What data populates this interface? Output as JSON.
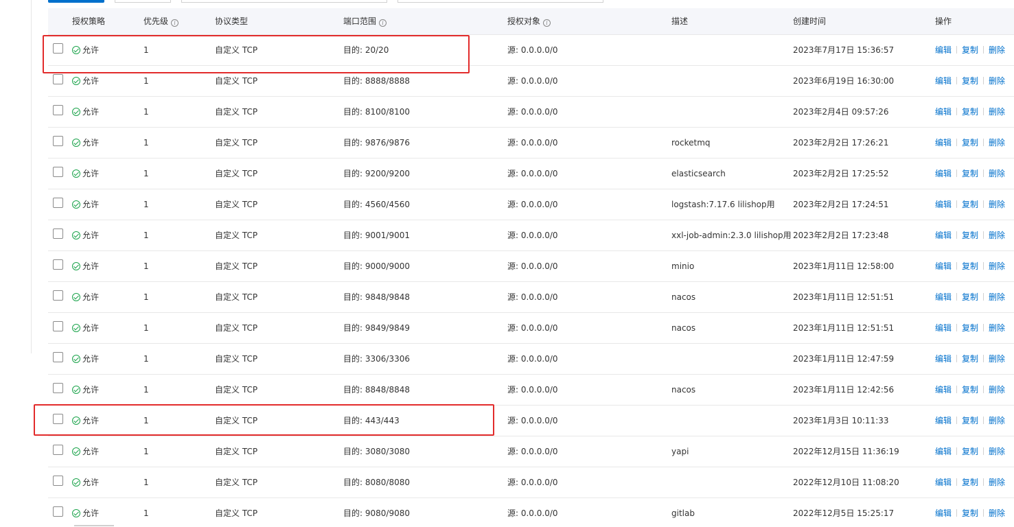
{
  "header": {
    "policy": "授权策略",
    "priority": "优先级",
    "protocol": "协议类型",
    "port_range": "端口范围",
    "auth_object": "授权对象",
    "description": "描述",
    "created_time": "创建时间",
    "actions": "操作"
  },
  "header_info_glyph": "i",
  "action_labels": {
    "edit": "编辑",
    "copy": "复制",
    "delete": "删除"
  },
  "rules": [
    {
      "policy": "允许",
      "priority": "1",
      "protocol": "自定义 TCP",
      "port": "目的: 20/20",
      "source": "源: 0.0.0.0/0",
      "description": "",
      "created": "2023年7月17日 15:36:57"
    },
    {
      "policy": "允许",
      "priority": "1",
      "protocol": "自定义 TCP",
      "port": "目的: 8888/8888",
      "source": "源: 0.0.0.0/0",
      "description": "",
      "created": "2023年6月19日 16:30:00"
    },
    {
      "policy": "允许",
      "priority": "1",
      "protocol": "自定义 TCP",
      "port": "目的: 8100/8100",
      "source": "源: 0.0.0.0/0",
      "description": "",
      "created": "2023年2月4日 09:57:26"
    },
    {
      "policy": "允许",
      "priority": "1",
      "protocol": "自定义 TCP",
      "port": "目的: 9876/9876",
      "source": "源: 0.0.0.0/0",
      "description": "rocketmq",
      "created": "2023年2月2日 17:26:21"
    },
    {
      "policy": "允许",
      "priority": "1",
      "protocol": "自定义 TCP",
      "port": "目的: 9200/9200",
      "source": "源: 0.0.0.0/0",
      "description": "elasticsearch",
      "created": "2023年2月2日 17:25:52"
    },
    {
      "policy": "允许",
      "priority": "1",
      "protocol": "自定义 TCP",
      "port": "目的: 4560/4560",
      "source": "源: 0.0.0.0/0",
      "description": "logstash:7.17.6 lilishop用",
      "created": "2023年2月2日 17:24:51"
    },
    {
      "policy": "允许",
      "priority": "1",
      "protocol": "自定义 TCP",
      "port": "目的: 9001/9001",
      "source": "源: 0.0.0.0/0",
      "description": "xxl-job-admin:2.3.0 lilishop用",
      "created": "2023年2月2日 17:23:48"
    },
    {
      "policy": "允许",
      "priority": "1",
      "protocol": "自定义 TCP",
      "port": "目的: 9000/9000",
      "source": "源: 0.0.0.0/0",
      "description": "minio",
      "created": "2023年1月11日 12:58:00"
    },
    {
      "policy": "允许",
      "priority": "1",
      "protocol": "自定义 TCP",
      "port": "目的: 9848/9848",
      "source": "源: 0.0.0.0/0",
      "description": "nacos",
      "created": "2023年1月11日 12:51:51"
    },
    {
      "policy": "允许",
      "priority": "1",
      "protocol": "自定义 TCP",
      "port": "目的: 9849/9849",
      "source": "源: 0.0.0.0/0",
      "description": "nacos",
      "created": "2023年1月11日 12:51:51"
    },
    {
      "policy": "允许",
      "priority": "1",
      "protocol": "自定义 TCP",
      "port": "目的: 3306/3306",
      "source": "源: 0.0.0.0/0",
      "description": "",
      "created": "2023年1月11日 12:47:59"
    },
    {
      "policy": "允许",
      "priority": "1",
      "protocol": "自定义 TCP",
      "port": "目的: 8848/8848",
      "source": "源: 0.0.0.0/0",
      "description": "nacos",
      "created": "2023年1月11日 12:42:56"
    },
    {
      "policy": "允许",
      "priority": "1",
      "protocol": "自定义 TCP",
      "port": "目的: 443/443",
      "source": "源: 0.0.0.0/0",
      "description": "",
      "created": "2023年1月3日 10:11:33"
    },
    {
      "policy": "允许",
      "priority": "1",
      "protocol": "自定义 TCP",
      "port": "目的: 3080/3080",
      "source": "源: 0.0.0.0/0",
      "description": "yapi",
      "created": "2022年12月15日 11:36:19"
    },
    {
      "policy": "允许",
      "priority": "1",
      "protocol": "自定义 TCP",
      "port": "目的: 8080/8080",
      "source": "源: 0.0.0.0/0",
      "description": "",
      "created": "2022年12月10日 11:08:20"
    },
    {
      "policy": "允许",
      "priority": "1",
      "protocol": "自定义 TCP",
      "port": "目的: 9080/9080",
      "source": "源: 0.0.0.0/0",
      "description": "gitlab",
      "created": "2022年12月5日 15:25:17"
    }
  ],
  "colors": {
    "link": "#0070cc",
    "allow": "#1aa34a",
    "highlight": "#e22b2b",
    "header_bg": "#f5f6fa"
  }
}
